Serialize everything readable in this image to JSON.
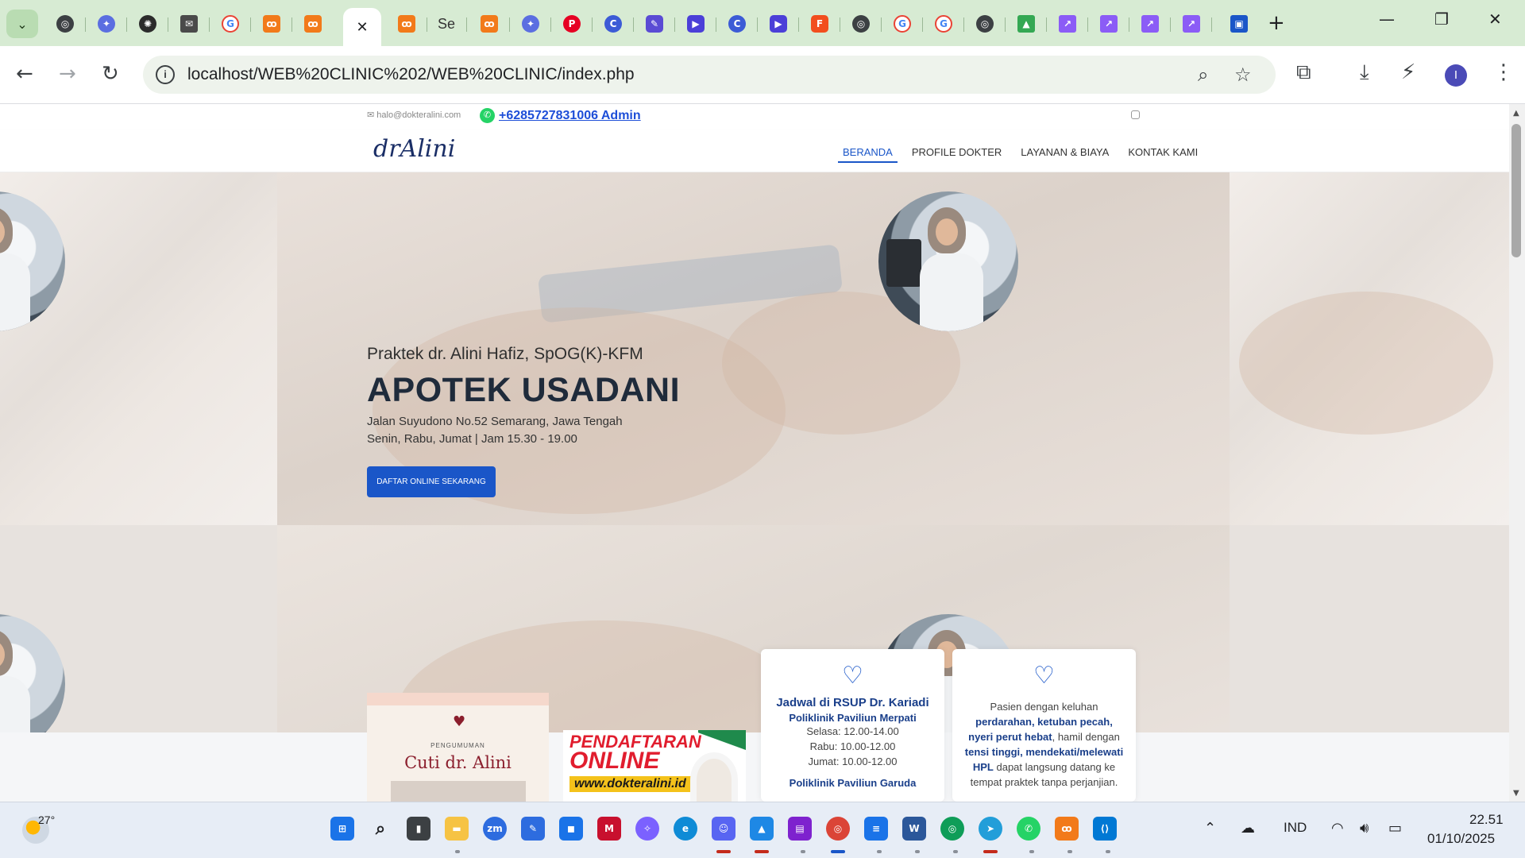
{
  "browser": {
    "tab_search_icon": "chevron-down-icon",
    "active_tab_close": "✕",
    "tab_text": "Se",
    "new_tab": "+",
    "window_controls": {
      "minimize": "—",
      "restore": "❐",
      "close": "✕"
    },
    "url": "localhost/WEB%20CLINIC%202/WEB%20CLINIC/index.php",
    "profile_initial": "I"
  },
  "site": {
    "email": "halo@dokteralini.com",
    "phone": "+6285727831006 Admin",
    "logo": "drAlini",
    "nav": {
      "home": "BERANDA",
      "profile": "PROFILE DOKTER",
      "services": "LAYANAN & BIAYA",
      "contact": "KONTAK KAMI"
    },
    "hero": {
      "subtitle": "Praktek dr. Alini Hafiz, SpOG(K)-KFM",
      "title": "APOTEK USADANI",
      "address": "Jalan Suyudono No.52 Semarang, Jawa Tengah",
      "hours": "Senin, Rabu, Jumat | Jam 15.30 - 19.00",
      "cta": "DAFTAR ONLINE SEKARANG"
    },
    "announcement": {
      "label": "PENGUMUMAN",
      "title": "Cuti dr. Alini"
    },
    "registration": {
      "line1": "PENDAFTARAN",
      "line2": "ONLINE",
      "line3": "www.dokteralini.id"
    },
    "schedule_card": {
      "title": "Jadwal di RSUP Dr. Kariadi",
      "subtitle": "Poliklinik Paviliun Merpati",
      "rows": [
        "Selasa: 12.00-14.00",
        "Rabu: 10.00-12.00",
        "Jumat: 10.00-12.00"
      ],
      "next": "Poliklinik Paviliun Garuda"
    },
    "emergency_card": {
      "t1": "Pasien dengan keluhan",
      "b1": "perdarahan, ketuban pecah, nyeri perut hebat",
      "t2": ", hamil dengan",
      "b2": "tensi tinggi, mendekati/melewati HPL",
      "t3": "dapat langsung datang ke tempat praktek tanpa perjanjian."
    }
  },
  "taskbar": {
    "temperature": "27°",
    "language": "IND",
    "time": "22.51",
    "date": "01/10/2025"
  },
  "colors": {
    "tabstrip": "#d7ebd3",
    "accent_blue": "#1a56c8",
    "brand_navy": "#1a3f8a",
    "registration_red": "#e11d2e"
  }
}
